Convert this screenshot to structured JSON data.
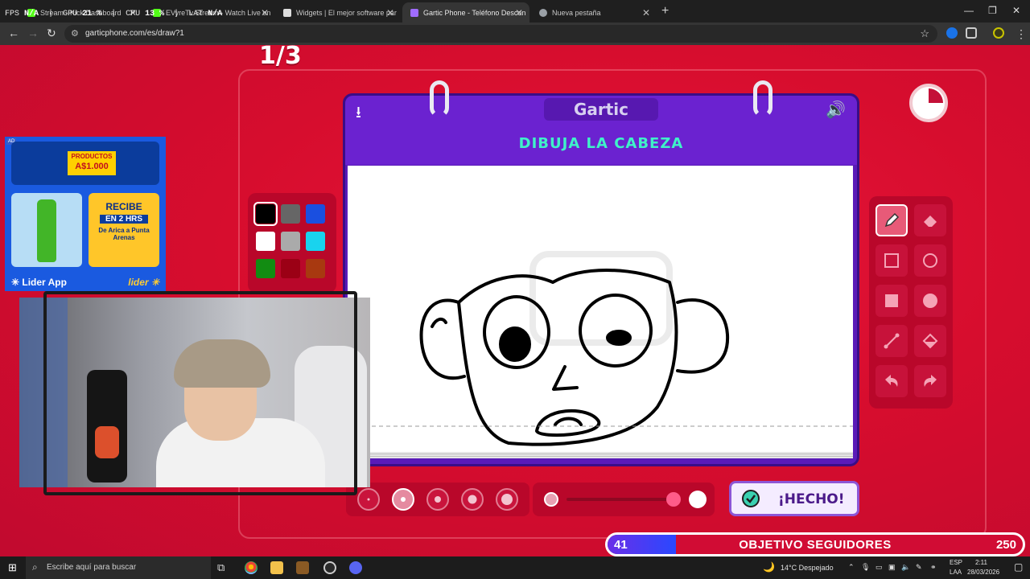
{
  "browser": {
    "tabs": [
      {
        "title": "Stream - Kick Dashboard",
        "fav": "#53fc18"
      },
      {
        "title": "EVyreTv Stream - Watch Live on",
        "fav": "#53fc18"
      },
      {
        "title": "Widgets | El mejor software par",
        "fav": "#dddddd"
      },
      {
        "title": "Gartic Phone - Teléfono Descon",
        "fav": "#a06cff"
      },
      {
        "title": "Nueva pestaña",
        "fav": "#9aa0a6"
      }
    ],
    "url": "garticphone.com/es/draw?1"
  },
  "stats_overlay": {
    "fps_label": "FPS",
    "fps": "N/A",
    "gpu_label": "GPU",
    "gpu": "21 %",
    "cpu_label": "CPU",
    "cpu": "13 %",
    "lat_label": "LAT",
    "lat": "N/A"
  },
  "game": {
    "round": "1/3",
    "brand": "Gartic",
    "prompt": "DIBUJA LA CABEZA",
    "done_button": "¡HECHO!",
    "timer_remaining_fraction": 0.75,
    "palette": [
      "#000000",
      "#666666",
      "#1a4fe0",
      "#ffffff",
      "#aaaaaa",
      "#19d3ee",
      "#128c12",
      "#9b0015",
      "#a83910"
    ],
    "selected_color": "#000000",
    "tools": [
      "pencil-icon",
      "eraser-icon",
      "rect-outline-icon",
      "circle-outline-icon",
      "rect-fill-icon",
      "circle-fill-icon",
      "line-icon",
      "bucket-icon",
      "undo-icon",
      "redo-icon"
    ],
    "selected_tool": "pencil-icon",
    "brush_sizes": 5,
    "selected_brush": 2
  },
  "ad": {
    "label": "AD",
    "badge_line1": "PRODUCTOS",
    "badge_line2": "A$1.000",
    "recibe": "RECIBE",
    "hrs": "EN 2 HRS",
    "route": "De Arica a Punta Arenas",
    "app": "Lider App",
    "brand": "lider"
  },
  "goal": {
    "current": "41",
    "label": "OBJETIVO SEGUIDORES",
    "target": "250",
    "progress": 0.164
  },
  "taskbar": {
    "search_placeholder": "Escribe aquí para buscar",
    "weather": "14°C  Despejado",
    "lang1": "ESP",
    "lang2": "LAA",
    "time": "2:11",
    "date": "28/03/2026"
  }
}
